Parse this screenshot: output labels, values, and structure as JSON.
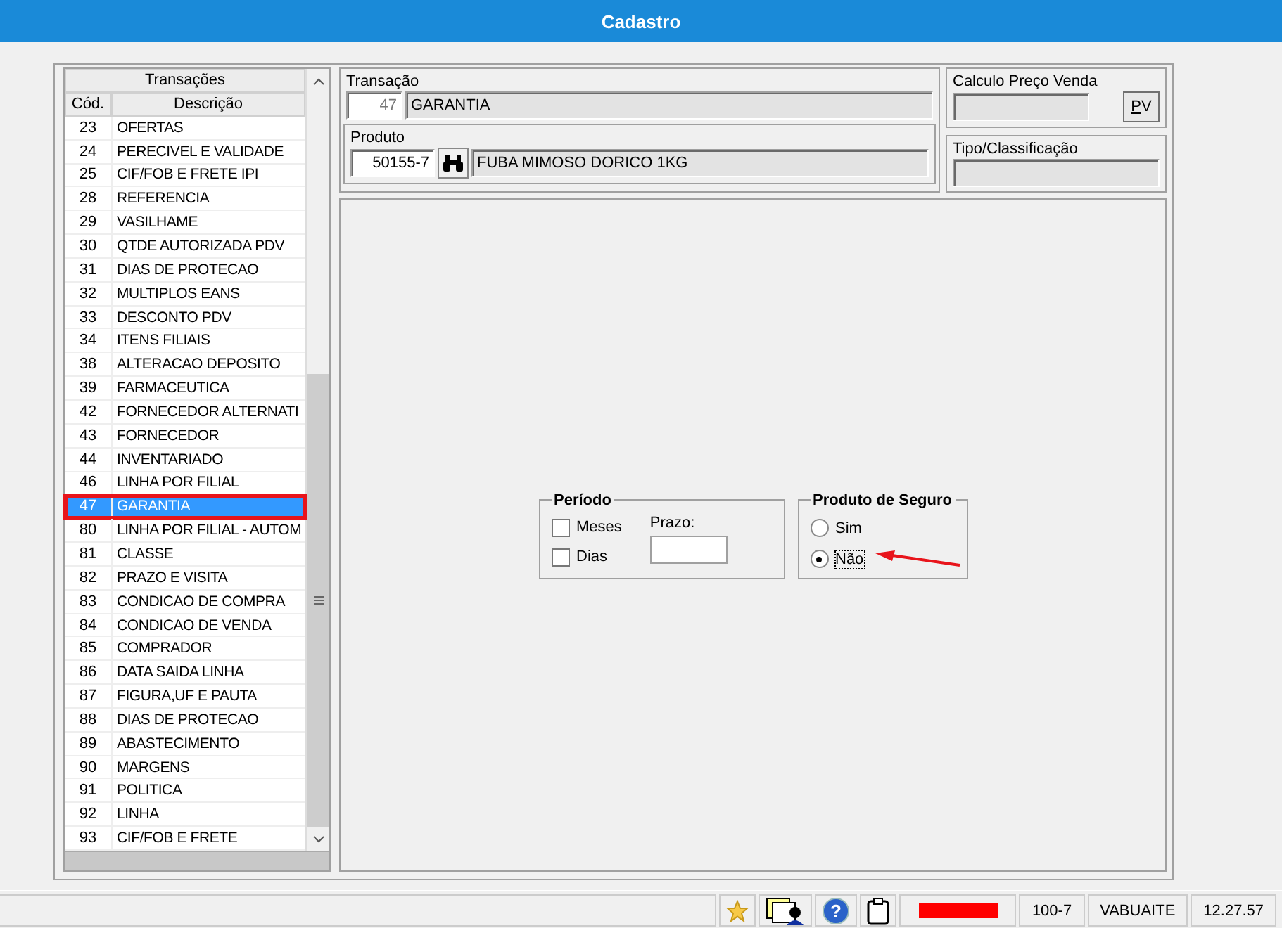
{
  "window": {
    "title": "Cadastro"
  },
  "transactions": {
    "title": "Transações",
    "columns": [
      "Cód.",
      "Descrição"
    ],
    "rows": [
      {
        "code": "23",
        "description": "OFERTAS",
        "selected": false,
        "highlighted": false
      },
      {
        "code": "24",
        "description": "PERECIVEL E VALIDADE",
        "selected": false,
        "highlighted": false
      },
      {
        "code": "25",
        "description": "CIF/FOB E FRETE IPI",
        "selected": false,
        "highlighted": false
      },
      {
        "code": "28",
        "description": "REFERENCIA",
        "selected": false,
        "highlighted": false
      },
      {
        "code": "29",
        "description": "VASILHAME",
        "selected": false,
        "highlighted": false
      },
      {
        "code": "30",
        "description": "QTDE AUTORIZADA PDV",
        "selected": false,
        "highlighted": false
      },
      {
        "code": "31",
        "description": "DIAS DE PROTECAO",
        "selected": false,
        "highlighted": false
      },
      {
        "code": "32",
        "description": "MULTIPLOS EANS",
        "selected": false,
        "highlighted": false
      },
      {
        "code": "33",
        "description": "DESCONTO PDV",
        "selected": false,
        "highlighted": false
      },
      {
        "code": "34",
        "description": "ITENS FILIAIS",
        "selected": false,
        "highlighted": false
      },
      {
        "code": "38",
        "description": "ALTERACAO DEPOSITO",
        "selected": false,
        "highlighted": false
      },
      {
        "code": "39",
        "description": "FARMACEUTICA",
        "selected": false,
        "highlighted": false
      },
      {
        "code": "42",
        "description": "FORNECEDOR ALTERNATI",
        "selected": false,
        "highlighted": false
      },
      {
        "code": "43",
        "description": "FORNECEDOR",
        "selected": false,
        "highlighted": false
      },
      {
        "code": "44",
        "description": "INVENTARIADO",
        "selected": false,
        "highlighted": false
      },
      {
        "code": "46",
        "description": "LINHA POR FILIAL",
        "selected": false,
        "highlighted": false
      },
      {
        "code": "47",
        "description": "GARANTIA",
        "selected": true,
        "highlighted": true
      },
      {
        "code": "80",
        "description": "LINHA POR FILIAL - AUTOM",
        "selected": false,
        "highlighted": false
      },
      {
        "code": "81",
        "description": "CLASSE",
        "selected": false,
        "highlighted": false
      },
      {
        "code": "82",
        "description": "PRAZO E VISITA",
        "selected": false,
        "highlighted": false
      },
      {
        "code": "83",
        "description": "CONDICAO DE COMPRA",
        "selected": false,
        "highlighted": false
      },
      {
        "code": "84",
        "description": "CONDICAO DE VENDA",
        "selected": false,
        "highlighted": false
      },
      {
        "code": "85",
        "description": "COMPRADOR",
        "selected": false,
        "highlighted": false
      },
      {
        "code": "86",
        "description": "DATA SAIDA LINHA",
        "selected": false,
        "highlighted": false
      },
      {
        "code": "87",
        "description": "FIGURA,UF E PAUTA",
        "selected": false,
        "highlighted": false
      },
      {
        "code": "88",
        "description": "DIAS DE PROTECAO",
        "selected": false,
        "highlighted": false
      },
      {
        "code": "89",
        "description": "ABASTECIMENTO",
        "selected": false,
        "highlighted": false
      },
      {
        "code": "90",
        "description": "MARGENS",
        "selected": false,
        "highlighted": false
      },
      {
        "code": "91",
        "description": "POLITICA",
        "selected": false,
        "highlighted": false
      },
      {
        "code": "92",
        "description": "LINHA",
        "selected": false,
        "highlighted": false
      },
      {
        "code": "93",
        "description": "CIF/FOB E FRETE",
        "selected": false,
        "highlighted": false
      }
    ]
  },
  "transacao": {
    "label": "Transação",
    "code": "47",
    "description": "GARANTIA"
  },
  "produto": {
    "label": "Produto",
    "code": "50155-7",
    "description": "FUBA MIMOSO DORICO 1KG"
  },
  "calculo": {
    "label": "Calculo Preço Venda",
    "button": "PV"
  },
  "tipo": {
    "label": "Tipo/Classificação"
  },
  "periodo": {
    "label": "Período",
    "options": [
      {
        "label": "Meses",
        "checked": false
      },
      {
        "label": "Dias",
        "checked": false
      }
    ],
    "prazo_label": "Prazo:"
  },
  "seguro": {
    "label": "Produto de Seguro",
    "options": [
      {
        "label": "Sim",
        "selected": false,
        "annotated": false
      },
      {
        "label": "Não",
        "selected": true,
        "annotated": true
      }
    ]
  },
  "status_bar": {
    "cells": [
      {
        "kind": "star"
      },
      {
        "kind": "user-window"
      },
      {
        "kind": "help",
        "glyph": "?"
      },
      {
        "kind": "clipboard"
      },
      {
        "kind": "redacted"
      },
      {
        "kind": "text",
        "text": "100-7"
      },
      {
        "kind": "text",
        "text": "VABUAITE"
      },
      {
        "kind": "text",
        "text": "12.27.57"
      }
    ]
  }
}
